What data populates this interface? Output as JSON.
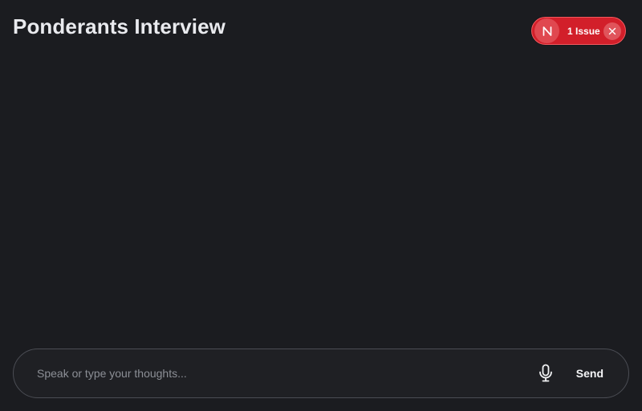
{
  "page": {
    "title": "Ponderants Interview"
  },
  "issue_indicator": {
    "badge_letter": "N",
    "label": "1 Issue",
    "colors": {
      "pill": "#d21f2a",
      "badge": "#e04850",
      "close": "#e0545b"
    },
    "icons": {
      "badge": "nextjs-n-icon",
      "close": "close-icon"
    }
  },
  "composer": {
    "placeholder": "Speak or type your thoughts...",
    "value": "",
    "send_label": "Send",
    "icons": {
      "mic": "microphone-icon"
    }
  },
  "theme": {
    "background": "#1b1c20",
    "input_border": "#4b4d54",
    "text": "#e9eaee",
    "placeholder": "#8c8f96"
  }
}
